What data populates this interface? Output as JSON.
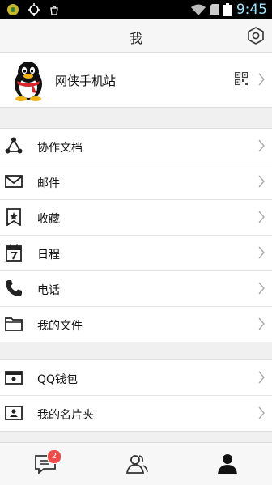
{
  "status_bar": {
    "time": "9:45"
  },
  "header": {
    "title": "我"
  },
  "profile": {
    "name": "网侠手机站"
  },
  "menu_group_1": [
    {
      "label": "协作文档",
      "icon": "share-network-icon"
    },
    {
      "label": "邮件",
      "icon": "mail-icon"
    },
    {
      "label": "收藏",
      "icon": "bookmark-star-icon"
    },
    {
      "label": "日程",
      "icon": "calendar-icon"
    },
    {
      "label": "电话",
      "icon": "phone-icon"
    },
    {
      "label": "我的文件",
      "icon": "folder-icon"
    }
  ],
  "menu_group_2": [
    {
      "label": "QQ钱包",
      "icon": "wallet-icon"
    },
    {
      "label": "我的名片夹",
      "icon": "card-holder-icon"
    }
  ],
  "tab_bar": {
    "messages_badge": "2",
    "tabs": [
      "messages-tab-icon",
      "contacts-tab-icon",
      "me-tab-icon"
    ]
  },
  "colors": {
    "badge": "#f04b4b",
    "clock": "#9ee3ff"
  }
}
